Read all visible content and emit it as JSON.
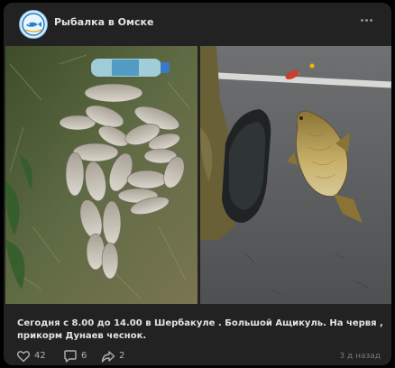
{
  "post": {
    "group_name": "Рыбалка в Омске",
    "text": "Сегодня с 8.00 до 14.00 в Шербакуле . Большой Ащикуль. На червя , прикорм Дунаев чеснок.",
    "timestamp": "3 д назад",
    "likes": "42",
    "comments": "6",
    "shares": "2",
    "icons": {
      "avatar": "fishing-club-logo",
      "more": "more-dots-icon",
      "like": "heart-icon",
      "comment": "comment-icon",
      "share": "share-arrow-icon"
    }
  },
  "colors": {
    "card": "#222222",
    "page": "#000000",
    "text": "#e1e3e6",
    "muted": "#76787b"
  }
}
